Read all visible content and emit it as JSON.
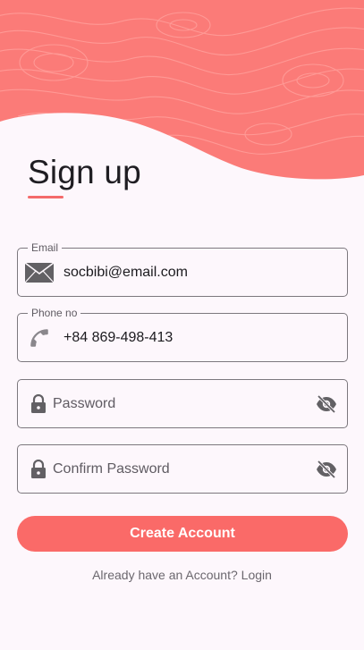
{
  "theme": {
    "accent": "#fa6a68",
    "hero_color": "#fb7b78",
    "background": "#fdf7fc"
  },
  "header": {
    "title": "Sign up"
  },
  "form": {
    "email": {
      "label": "Email",
      "value": "socbibi@email.com",
      "icon": "envelope-icon"
    },
    "phone": {
      "label": "Phone no",
      "value": "+84 869-498-413",
      "icon": "phone-icon"
    },
    "password": {
      "placeholder": "Password",
      "icon": "lock-icon",
      "toggle_icon": "eye-off-icon"
    },
    "confirm_password": {
      "placeholder": "Confirm Password",
      "icon": "lock-icon",
      "toggle_icon": "eye-off-icon"
    }
  },
  "actions": {
    "create_account_label": "Create Account",
    "login_prompt": "Already have an Account? Login"
  }
}
